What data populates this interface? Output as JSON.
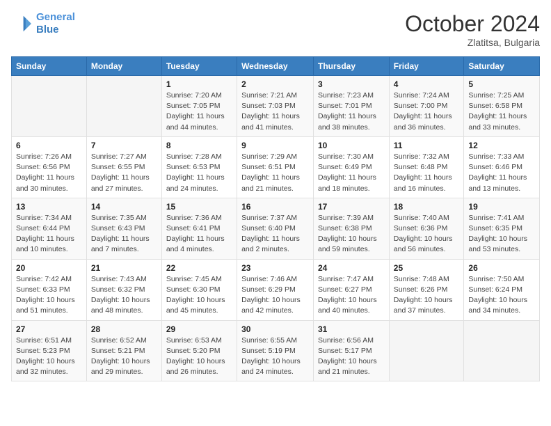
{
  "header": {
    "logo_line1": "General",
    "logo_line2": "Blue",
    "month": "October 2024",
    "location": "Zlatitsa, Bulgaria"
  },
  "weekdays": [
    "Sunday",
    "Monday",
    "Tuesday",
    "Wednesday",
    "Thursday",
    "Friday",
    "Saturday"
  ],
  "weeks": [
    [
      {
        "day": "",
        "sunrise": "",
        "sunset": "",
        "daylight": ""
      },
      {
        "day": "",
        "sunrise": "",
        "sunset": "",
        "daylight": ""
      },
      {
        "day": "1",
        "sunrise": "Sunrise: 7:20 AM",
        "sunset": "Sunset: 7:05 PM",
        "daylight": "Daylight: 11 hours and 44 minutes."
      },
      {
        "day": "2",
        "sunrise": "Sunrise: 7:21 AM",
        "sunset": "Sunset: 7:03 PM",
        "daylight": "Daylight: 11 hours and 41 minutes."
      },
      {
        "day": "3",
        "sunrise": "Sunrise: 7:23 AM",
        "sunset": "Sunset: 7:01 PM",
        "daylight": "Daylight: 11 hours and 38 minutes."
      },
      {
        "day": "4",
        "sunrise": "Sunrise: 7:24 AM",
        "sunset": "Sunset: 7:00 PM",
        "daylight": "Daylight: 11 hours and 36 minutes."
      },
      {
        "day": "5",
        "sunrise": "Sunrise: 7:25 AM",
        "sunset": "Sunset: 6:58 PM",
        "daylight": "Daylight: 11 hours and 33 minutes."
      }
    ],
    [
      {
        "day": "6",
        "sunrise": "Sunrise: 7:26 AM",
        "sunset": "Sunset: 6:56 PM",
        "daylight": "Daylight: 11 hours and 30 minutes."
      },
      {
        "day": "7",
        "sunrise": "Sunrise: 7:27 AM",
        "sunset": "Sunset: 6:55 PM",
        "daylight": "Daylight: 11 hours and 27 minutes."
      },
      {
        "day": "8",
        "sunrise": "Sunrise: 7:28 AM",
        "sunset": "Sunset: 6:53 PM",
        "daylight": "Daylight: 11 hours and 24 minutes."
      },
      {
        "day": "9",
        "sunrise": "Sunrise: 7:29 AM",
        "sunset": "Sunset: 6:51 PM",
        "daylight": "Daylight: 11 hours and 21 minutes."
      },
      {
        "day": "10",
        "sunrise": "Sunrise: 7:30 AM",
        "sunset": "Sunset: 6:49 PM",
        "daylight": "Daylight: 11 hours and 18 minutes."
      },
      {
        "day": "11",
        "sunrise": "Sunrise: 7:32 AM",
        "sunset": "Sunset: 6:48 PM",
        "daylight": "Daylight: 11 hours and 16 minutes."
      },
      {
        "day": "12",
        "sunrise": "Sunrise: 7:33 AM",
        "sunset": "Sunset: 6:46 PM",
        "daylight": "Daylight: 11 hours and 13 minutes."
      }
    ],
    [
      {
        "day": "13",
        "sunrise": "Sunrise: 7:34 AM",
        "sunset": "Sunset: 6:44 PM",
        "daylight": "Daylight: 11 hours and 10 minutes."
      },
      {
        "day": "14",
        "sunrise": "Sunrise: 7:35 AM",
        "sunset": "Sunset: 6:43 PM",
        "daylight": "Daylight: 11 hours and 7 minutes."
      },
      {
        "day": "15",
        "sunrise": "Sunrise: 7:36 AM",
        "sunset": "Sunset: 6:41 PM",
        "daylight": "Daylight: 11 hours and 4 minutes."
      },
      {
        "day": "16",
        "sunrise": "Sunrise: 7:37 AM",
        "sunset": "Sunset: 6:40 PM",
        "daylight": "Daylight: 11 hours and 2 minutes."
      },
      {
        "day": "17",
        "sunrise": "Sunrise: 7:39 AM",
        "sunset": "Sunset: 6:38 PM",
        "daylight": "Daylight: 10 hours and 59 minutes."
      },
      {
        "day": "18",
        "sunrise": "Sunrise: 7:40 AM",
        "sunset": "Sunset: 6:36 PM",
        "daylight": "Daylight: 10 hours and 56 minutes."
      },
      {
        "day": "19",
        "sunrise": "Sunrise: 7:41 AM",
        "sunset": "Sunset: 6:35 PM",
        "daylight": "Daylight: 10 hours and 53 minutes."
      }
    ],
    [
      {
        "day": "20",
        "sunrise": "Sunrise: 7:42 AM",
        "sunset": "Sunset: 6:33 PM",
        "daylight": "Daylight: 10 hours and 51 minutes."
      },
      {
        "day": "21",
        "sunrise": "Sunrise: 7:43 AM",
        "sunset": "Sunset: 6:32 PM",
        "daylight": "Daylight: 10 hours and 48 minutes."
      },
      {
        "day": "22",
        "sunrise": "Sunrise: 7:45 AM",
        "sunset": "Sunset: 6:30 PM",
        "daylight": "Daylight: 10 hours and 45 minutes."
      },
      {
        "day": "23",
        "sunrise": "Sunrise: 7:46 AM",
        "sunset": "Sunset: 6:29 PM",
        "daylight": "Daylight: 10 hours and 42 minutes."
      },
      {
        "day": "24",
        "sunrise": "Sunrise: 7:47 AM",
        "sunset": "Sunset: 6:27 PM",
        "daylight": "Daylight: 10 hours and 40 minutes."
      },
      {
        "day": "25",
        "sunrise": "Sunrise: 7:48 AM",
        "sunset": "Sunset: 6:26 PM",
        "daylight": "Daylight: 10 hours and 37 minutes."
      },
      {
        "day": "26",
        "sunrise": "Sunrise: 7:50 AM",
        "sunset": "Sunset: 6:24 PM",
        "daylight": "Daylight: 10 hours and 34 minutes."
      }
    ],
    [
      {
        "day": "27",
        "sunrise": "Sunrise: 6:51 AM",
        "sunset": "Sunset: 5:23 PM",
        "daylight": "Daylight: 10 hours and 32 minutes."
      },
      {
        "day": "28",
        "sunrise": "Sunrise: 6:52 AM",
        "sunset": "Sunset: 5:21 PM",
        "daylight": "Daylight: 10 hours and 29 minutes."
      },
      {
        "day": "29",
        "sunrise": "Sunrise: 6:53 AM",
        "sunset": "Sunset: 5:20 PM",
        "daylight": "Daylight: 10 hours and 26 minutes."
      },
      {
        "day": "30",
        "sunrise": "Sunrise: 6:55 AM",
        "sunset": "Sunset: 5:19 PM",
        "daylight": "Daylight: 10 hours and 24 minutes."
      },
      {
        "day": "31",
        "sunrise": "Sunrise: 6:56 AM",
        "sunset": "Sunset: 5:17 PM",
        "daylight": "Daylight: 10 hours and 21 minutes."
      },
      {
        "day": "",
        "sunrise": "",
        "sunset": "",
        "daylight": ""
      },
      {
        "day": "",
        "sunrise": "",
        "sunset": "",
        "daylight": ""
      }
    ]
  ]
}
